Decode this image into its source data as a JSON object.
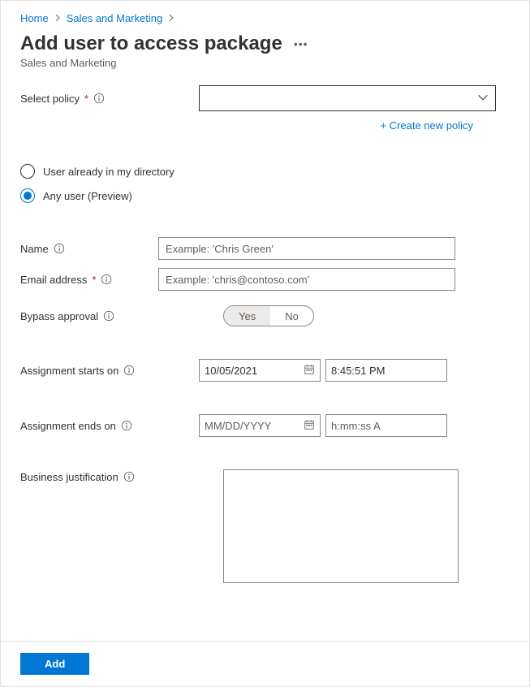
{
  "breadcrumb": {
    "home": "Home",
    "section": "Sales and Marketing"
  },
  "page": {
    "title": "Add user to access package",
    "subtitle": "Sales and Marketing"
  },
  "select_policy": {
    "label": "Select policy",
    "create_link": "+ Create new policy"
  },
  "radios": {
    "existing": "User already in my directory",
    "any": "Any user (Preview)"
  },
  "fields": {
    "name_label": "Name",
    "name_placeholder": "Example: 'Chris Green'",
    "email_label": "Email address",
    "email_placeholder": "Example: 'chris@contoso.com'",
    "bypass_label": "Bypass approval",
    "bypass_yes": "Yes",
    "bypass_no": "No",
    "starts_label": "Assignment starts on",
    "starts_date": "10/05/2021",
    "starts_time": "8:45:51 PM",
    "ends_label": "Assignment ends on",
    "ends_date_placeholder": "MM/DD/YYYY",
    "ends_time_placeholder": "h:mm:ss A",
    "justification_label": "Business justification"
  },
  "footer": {
    "add": "Add"
  }
}
